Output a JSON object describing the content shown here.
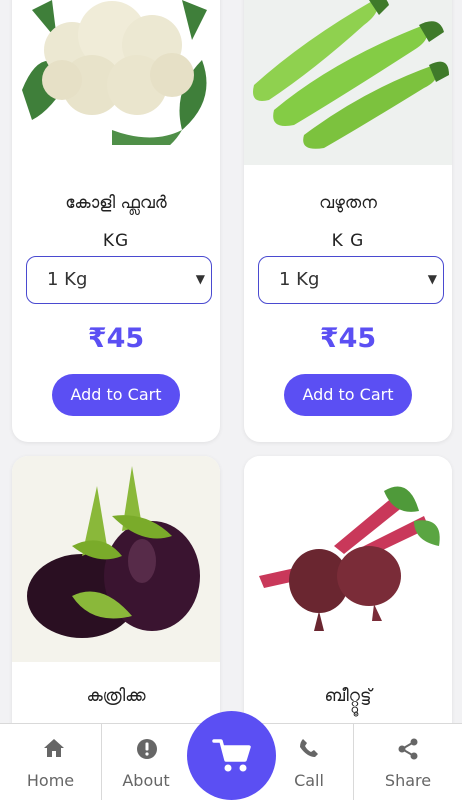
{
  "products": [
    {
      "name": "കോളി ഫ്ലവർ",
      "unit": "KG",
      "selected_option": "1 Kg",
      "price": "₹45",
      "add_label": "Add to Cart",
      "image_icon": "cauliflower-image"
    },
    {
      "name": "വഴുതന",
      "unit": "K G",
      "selected_option": "1 Kg",
      "price": "₹45",
      "add_label": "Add to Cart",
      "image_icon": "long-eggplant-image"
    },
    {
      "name": "കത്രിക്ക",
      "image_icon": "eggplant-image"
    },
    {
      "name": "ബീറ്റ്റൂട്ട്",
      "image_icon": "beetroot-image"
    }
  ],
  "bottom_nav": {
    "items": [
      {
        "label": "Home",
        "icon": "home-icon"
      },
      {
        "label": "About",
        "icon": "info-icon"
      },
      {
        "label": "Call",
        "icon": "phone-icon"
      },
      {
        "label": "Share",
        "icon": "share-icon"
      }
    ],
    "cart_icon": "cart-icon"
  },
  "colors": {
    "accent": "#5b4ff3",
    "select_border": "#4a4ad0",
    "nav_text": "#666666"
  }
}
